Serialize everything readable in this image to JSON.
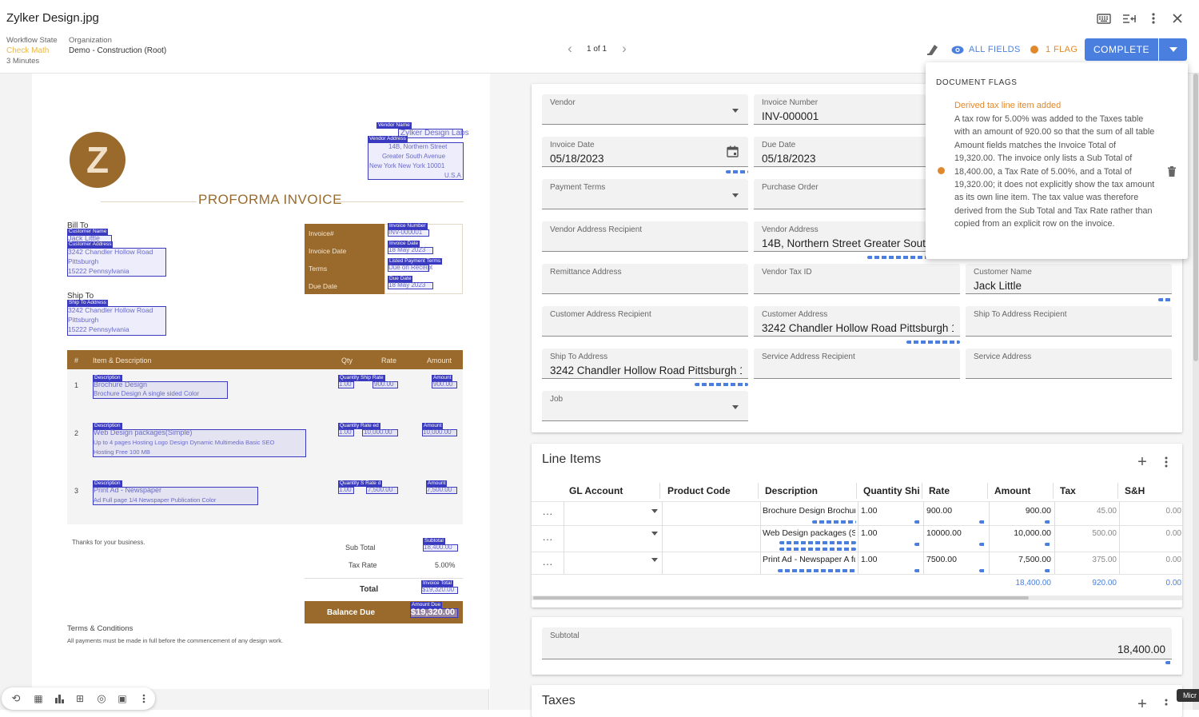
{
  "header": {
    "file_name": "Zylker Design.jpg",
    "workflow_state_label": "Workflow State",
    "workflow_state_value": "Check Math",
    "workflow_time": "3 Minutes",
    "organization_label": "Organization",
    "organization_value": "Demo - Construction (Root)",
    "pager": "1 of 1",
    "all_fields": "ALL FIELDS",
    "flag_count": "1 FLAG",
    "complete": "COMPLETE",
    "colors": {
      "accent": "#4a7fe0",
      "flag": "#e0892c",
      "state": "#e8b84a"
    }
  },
  "flags": {
    "title": "DOCUMENT FLAGS",
    "items": [
      {
        "heading": "Derived tax line item added",
        "body": "A tax row for 5.00% was added to the Taxes table with an amount of 920.00 so that the sum of all table Amount fields matches the Invoice Total of 19,320.00. The invoice only lists a Sub Total of 18,400.00, a Tax Rate of 5.00%, and a Total of 19,320.00; it does not explicitly show the tax amount as its own line item. The tax value was therefore derived from the Sub Total and Tax Rate rather than copied from an explicit row on the invoice."
      }
    ]
  },
  "fields": {
    "vendor": {
      "label": "Vendor",
      "value": ""
    },
    "invoice_number": {
      "label": "Invoice Number",
      "value": "INV-000001"
    },
    "invoice_date": {
      "label": "Invoice Date",
      "value": "05/18/2023"
    },
    "due_date": {
      "label": "Due Date",
      "value": "05/18/2023"
    },
    "payment_terms": {
      "label": "Payment Terms",
      "value": ""
    },
    "purchase_order": {
      "label": "Purchase Order",
      "value": ""
    },
    "vendor_address_recipient": {
      "label": "Vendor Address Recipient",
      "value": ""
    },
    "vendor_address": {
      "label": "Vendor Address",
      "value": "14B, Northern Street Greater South"
    },
    "remittance_address": {
      "label": "Remittance Address",
      "value": ""
    },
    "vendor_tax_id": {
      "label": "Vendor Tax ID",
      "value": ""
    },
    "customer_name": {
      "label": "Customer Name",
      "value": "Jack Little"
    },
    "customer_address_recipient": {
      "label": "Customer Address Recipient",
      "value": ""
    },
    "customer_address": {
      "label": "Customer Address",
      "value": "3242 Chandler Hollow Road Pittsburgh 1"
    },
    "ship_to_address_recipient": {
      "label": "Ship To Address Recipient",
      "value": ""
    },
    "ship_to_address": {
      "label": "Ship To Address",
      "value": "3242 Chandler Hollow Road Pittsburgh 1"
    },
    "service_address_recipient": {
      "label": "Service Address Recipient",
      "value": ""
    },
    "service_address": {
      "label": "Service Address",
      "value": ""
    },
    "job": {
      "label": "Job",
      "value": ""
    }
  },
  "line_items": {
    "title": "Line Items",
    "columns": [
      "GL Account",
      "Product Code",
      "Description",
      "Quantity Shi",
      "Rate",
      "Amount",
      "Tax",
      "S&H"
    ],
    "rows": [
      {
        "description": "Brochure Design Brochure",
        "qty": "1.00",
        "rate": "900.00",
        "amount": "900.00",
        "tax": "45.00",
        "sh": "0.00"
      },
      {
        "description": "Web Design packages (Si",
        "qty": "1.00",
        "rate": "10000.00",
        "amount": "10,000.00",
        "tax": "500.00",
        "sh": "0.00"
      },
      {
        "description": "Print Ad - Newspaper A ful",
        "qty": "1.00",
        "rate": "7500.00",
        "amount": "7,500.00",
        "tax": "375.00",
        "sh": "0.00"
      }
    ],
    "totals": {
      "amount": "18,400.00",
      "tax": "920.00",
      "sh": "0.00"
    }
  },
  "subtotal": {
    "label": "Subtotal",
    "value": "18,400.00"
  },
  "taxes": {
    "title": "Taxes"
  },
  "document": {
    "title": "PROFORMA INVOICE",
    "logo_letter": "Z",
    "vendor_name_tag": "Vendor Name",
    "vendor_name": "Zylker Design Labs",
    "vendor_address_tag": "Vendor Address",
    "vendor_address_lines": [
      "14B, Northern Street",
      "Greater South Avenue",
      "New York New York 10001",
      "U.S.A"
    ],
    "bill_to": "Bill To",
    "customer_name_tag": "Customer Name",
    "customer_name": "Jack Little",
    "customer_address_tag": "Customer Address",
    "customer_address_lines": [
      "3242 Chandler Hollow Road",
      "Pittsburgh",
      "15222 Pennsylvania"
    ],
    "ship_to": "Ship To",
    "ship_to_tag": "Ship To Address",
    "ship_to_lines": [
      "3242 Chandler Hollow Road",
      "Pittsburgh",
      "15222 Pennsylvania"
    ],
    "meta": [
      {
        "label": "Invoice#",
        "tag": "Invoice Number",
        "value": "INV-000001"
      },
      {
        "label": "Invoice Date",
        "tag": "Invoice Date",
        "value": "18 May 2023"
      },
      {
        "label": "Terms",
        "tag": "Listed Payment Terms",
        "value": "Due on Receipt"
      },
      {
        "label": "Due Date",
        "tag": "Due Date",
        "value": "18 May 2023"
      }
    ],
    "table_headers": [
      "#",
      "Item & Description",
      "Qty",
      "Rate",
      "Amount"
    ],
    "rows": [
      {
        "num": "1",
        "desc_tag": "Description",
        "desc1": "Brochure Design",
        "desc2": "Brochure Design A single sided Color",
        "qty_tag": "Quantity Ship Rate",
        "qty": "1.00",
        "rate": "900.00",
        "amt_tag": "Amount",
        "amt": "900.00"
      },
      {
        "num": "2",
        "desc_tag": "Description",
        "desc1": "Web Design packages(Simple)",
        "desc2": "Up to 4 pages Hosting Logo Design Dynamic Multimedia Basic SEO",
        "desc3": "Hosting Free 100 MB",
        "qty_tag": "Quantity Rate ed",
        "qty": "1.00",
        "rate": "10,000.00",
        "amt_tag": "Amount",
        "amt": "10,000.00"
      },
      {
        "num": "3",
        "desc_tag": "Description",
        "desc1": "Print Ad - Newspaper",
        "desc2": "Ad Full page 1/4 Newspaper Publication Color",
        "qty_tag": "Quantity S Rate d",
        "qty": "1.00",
        "rate": "7,500.00",
        "amt_tag": "Amount",
        "amt": "7,500.00"
      }
    ],
    "thanks": "Thanks for your business.",
    "sub_total_label": "Sub Total",
    "sub_total_tag": "Subtotal",
    "sub_total": "18,400.00",
    "tax_rate_label": "Tax Rate",
    "tax_rate": "5.00%",
    "total_label": "Total",
    "total_tag": "Invoice Total",
    "total": "$19,320.00",
    "balance_label": "Balance Due",
    "balance_tag": "Amount Due",
    "balance": "$19,320.00",
    "terms_title": "Terms & Conditions",
    "terms_text": "All payments must be made in full before the commencement of any design work."
  },
  "footer_tooltip": "Micr"
}
